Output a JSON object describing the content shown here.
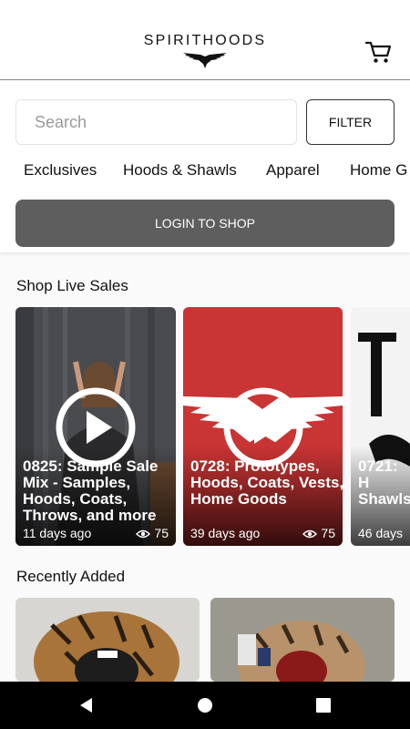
{
  "header": {
    "brand": "SPIRITHOODS",
    "logo_icon": "wings-logo-icon",
    "cart_icon": "cart-icon"
  },
  "search": {
    "placeholder": "Search",
    "filter_label": "FILTER"
  },
  "categories": [
    "Exclusives",
    "Hoods & Shawls",
    "Apparel",
    "Home G"
  ],
  "login_label": "LOGIN TO SHOP",
  "sections": {
    "live_sales_title": "Shop Live Sales",
    "recently_added_title": "Recently Added"
  },
  "live_sales": [
    {
      "title": "0825: Sample Sale Mix - Samples, Hoods, Coats, Throws, and more",
      "age": "11 days ago",
      "views": "75"
    },
    {
      "title": "0728: Prototypes, Hoods, Coats, Vests, Home Goods",
      "age": "39 days ago",
      "views": "75"
    },
    {
      "title": "0721: H Shawls,",
      "age": "46 days",
      "views": ""
    }
  ],
  "navbar": {
    "back_icon": "back-triangle-icon",
    "home_icon": "home-circle-icon",
    "recents_icon": "recents-square-icon"
  },
  "colors": {
    "login_bg": "#5e5e5e",
    "sale_red": "#c93434",
    "navbar_bg": "#000000"
  }
}
